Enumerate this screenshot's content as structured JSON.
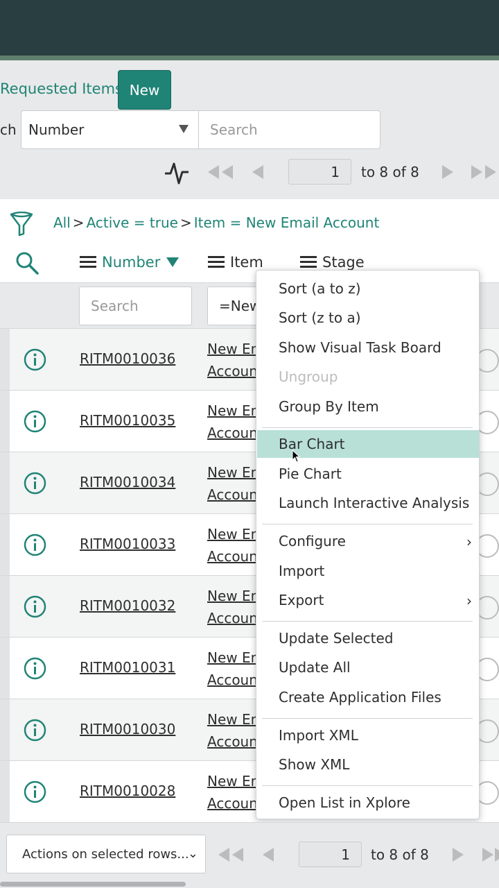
{
  "header": {
    "list_title": "Requested Items",
    "new_button": "New",
    "search_prefix": "ch",
    "search_field_selected": "Number",
    "search_placeholder": "Search"
  },
  "pager_top": {
    "page": "1",
    "range_text": "to 8 of 8"
  },
  "breadcrumb": {
    "all": "All",
    "sep": ">",
    "c1": "Active = true",
    "c2": "Item = New Email Account"
  },
  "columns": {
    "number": "Number",
    "item": "Item",
    "stage": "Stage"
  },
  "filters": {
    "number_placeholder": "Search",
    "item_value": "=New"
  },
  "rows": [
    {
      "number": "RITM0010036",
      "item_l1": "New Em",
      "item_l2": "Accoun"
    },
    {
      "number": "RITM0010035",
      "item_l1": "New Em",
      "item_l2": "Accoun"
    },
    {
      "number": "RITM0010034",
      "item_l1": "New Em",
      "item_l2": "Accoun"
    },
    {
      "number": "RITM0010033",
      "item_l1": "New Em",
      "item_l2": "Accoun"
    },
    {
      "number": "RITM0010032",
      "item_l1": "New Em",
      "item_l2": "Accoun"
    },
    {
      "number": "RITM0010031",
      "item_l1": "New Em",
      "item_l2": "Accoun"
    },
    {
      "number": "RITM0010030",
      "item_l1": "New Em",
      "item_l2": "Accoun"
    },
    {
      "number": "RITM0010028",
      "item_l1": "New Em",
      "item_l2": "Accoun"
    }
  ],
  "context_menu": {
    "sort_az": "Sort (a to z)",
    "sort_za": "Sort (z to a)",
    "visual_task_board": "Show Visual Task Board",
    "ungroup": "Ungroup",
    "group_by": "Group By Item",
    "bar_chart": "Bar Chart",
    "pie_chart": "Pie Chart",
    "interactive_analysis": "Launch Interactive Analysis",
    "configure": "Configure",
    "import": "Import",
    "export": "Export",
    "update_selected": "Update Selected",
    "update_all": "Update All",
    "create_app_files": "Create Application Files",
    "import_xml": "Import XML",
    "show_xml": "Show XML",
    "open_xplore": "Open List in Xplore"
  },
  "footer": {
    "actions_select": "Actions on selected rows...",
    "page": "1",
    "range_text": "to 8 of 8"
  },
  "icons": {
    "activity": "activity-stream-icon",
    "first": "first-page-icon",
    "prev": "previous-page-icon",
    "next": "next-page-icon",
    "last": "last-page-icon",
    "filter": "filter-funnel-icon",
    "search": "search-icon",
    "info": "info-icon",
    "hamburger": "column-menu-icon"
  },
  "colors": {
    "accent": "#1f8476",
    "topbar": "#293e40",
    "highlight": "#b8e0d7"
  }
}
